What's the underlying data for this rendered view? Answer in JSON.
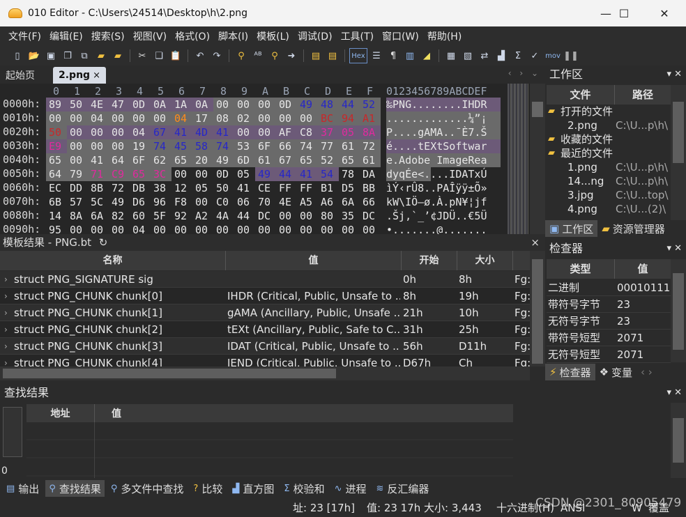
{
  "window": {
    "title": "010 Editor - C:\\Users\\24514\\Desktop\\h\\2.png",
    "controls": {
      "minimize": "—",
      "maximize": "☐",
      "close": "✕"
    }
  },
  "menu": [
    "文件(F)",
    "编辑(E)",
    "搜索(S)",
    "视图(V)",
    "格式(O)",
    "脚本(I)",
    "模板(L)",
    "调试(D)",
    "工具(T)",
    "窗口(W)",
    "帮助(H)"
  ],
  "toolbar": {
    "icons": [
      "new-file-icon",
      "open-folder-icon",
      "save-icon",
      "save-as-icon",
      "save-all-icon",
      "folder-icon",
      "folders-icon",
      "cut-icon",
      "copy-icon",
      "paste-icon",
      "undo-icon",
      "redo-icon",
      "find-icon",
      "find-replace-icon",
      "find-in-files-icon",
      "goto-icon",
      "template-icon",
      "script-icon",
      "hex-mode-icon",
      "text-mode-icon",
      "pilcrow-icon",
      "columns-icon",
      "highlight-icon",
      "calculator-icon",
      "inspector-icon",
      "compare-icon",
      "histogram-icon",
      "checksum-icon",
      "select-icon",
      "mov-icon",
      "pause-icon"
    ],
    "hex_label": "Hex",
    "mov_label": "mov"
  },
  "tabs": {
    "start": "起始页",
    "file": "2.png",
    "close": "×",
    "arrows": "‹ › ⌄"
  },
  "hex": {
    "col_header": [
      "0",
      "1",
      "2",
      "3",
      "4",
      "5",
      "6",
      "7",
      "8",
      "9",
      "A",
      "B",
      "C",
      "D",
      "E",
      "F"
    ],
    "ascii_header": "0123456789ABCDEF",
    "rows": [
      {
        "addr": "0000h:",
        "bytes": [
          "89",
          "50",
          "4E",
          "47",
          "0D",
          "0A",
          "1A",
          "0A",
          "00",
          "00",
          "00",
          "0D",
          "49",
          "48",
          "44",
          "52"
        ],
        "ascii": "‰PNG........IHDR"
      },
      {
        "addr": "0010h:",
        "bytes": [
          "00",
          "00",
          "04",
          "00",
          "00",
          "00",
          "04",
          "17",
          "08",
          "02",
          "00",
          "00",
          "00",
          "BC",
          "94",
          "A1"
        ],
        "ascii": ".............¼”¡"
      },
      {
        "addr": "0020h:",
        "bytes": [
          "50",
          "00",
          "00",
          "00",
          "04",
          "67",
          "41",
          "4D",
          "41",
          "00",
          "00",
          "AF",
          "C8",
          "37",
          "05",
          "8A"
        ],
        "ascii": "P....gAMA..¯È7.Š"
      },
      {
        "addr": "0030h:",
        "bytes": [
          "E9",
          "00",
          "00",
          "00",
          "19",
          "74",
          "45",
          "58",
          "74",
          "53",
          "6F",
          "66",
          "74",
          "77",
          "61",
          "72"
        ],
        "ascii": "é....tEXtSoftwar"
      },
      {
        "addr": "0040h:",
        "bytes": [
          "65",
          "00",
          "41",
          "64",
          "6F",
          "62",
          "65",
          "20",
          "49",
          "6D",
          "61",
          "67",
          "65",
          "52",
          "65",
          "61"
        ],
        "ascii": "e.Adobe ImageRea"
      },
      {
        "addr": "0050h:",
        "bytes": [
          "64",
          "79",
          "71",
          "C9",
          "65",
          "3C",
          "00",
          "00",
          "0D",
          "05",
          "49",
          "44",
          "41",
          "54",
          "78",
          "DA"
        ],
        "ascii": "dyqÉe<....IDATxÚ"
      },
      {
        "addr": "0060h:",
        "bytes": [
          "EC",
          "DD",
          "8B",
          "72",
          "DB",
          "38",
          "12",
          "05",
          "50",
          "41",
          "CE",
          "FF",
          "FF",
          "B1",
          "D5",
          "BB"
        ],
        "ascii": "ìÝ‹rÛ8..PAÎÿÿ±Õ»"
      },
      {
        "addr": "0070h:",
        "bytes": [
          "6B",
          "57",
          "5C",
          "49",
          "D6",
          "96",
          "F8",
          "00",
          "C0",
          "06",
          "70",
          "4E",
          "A5",
          "A6",
          "6A",
          "66"
        ],
        "ascii": "kW\\IÖ–ø.À.pN¥¦jf"
      },
      {
        "addr": "0080h:",
        "bytes": [
          "14",
          "8A",
          "6A",
          "82",
          "60",
          "5F",
          "92",
          "A2",
          "4A",
          "44",
          "DC",
          "00",
          "00",
          "80",
          "35",
          "DC"
        ],
        "ascii": ".Šj‚`_’¢JDÜ..€5Ü"
      },
      {
        "addr": "0090h:",
        "bytes": [
          "95",
          "00",
          "00",
          "00",
          "04",
          "00",
          "00",
          "00",
          "00",
          "00",
          "00",
          "00",
          "00",
          "00",
          "00",
          "00"
        ],
        "ascii": "•.......@......."
      }
    ]
  },
  "template": {
    "title": "模板结果 - PNG.bt",
    "refresh": "↻",
    "close": "×",
    "columns": [
      "名称",
      "值",
      "开始",
      "大小",
      ""
    ],
    "rows": [
      {
        "name": "struct PNG_SIGNATURE sig",
        "value": "",
        "start": "0h",
        "size": "8h",
        "color": "Fg:"
      },
      {
        "name": "struct PNG_CHUNK chunk[0]",
        "value": "IHDR  (Critical, Public, Unsafe to ...",
        "start": "8h",
        "size": "19h",
        "color": "Fg:"
      },
      {
        "name": "struct PNG_CHUNK chunk[1]",
        "value": "gAMA  (Ancillary, Public, Unsafe ...",
        "start": "21h",
        "size": "10h",
        "color": "Fg:"
      },
      {
        "name": "struct PNG_CHUNK chunk[2]",
        "value": "tEXt  (Ancillary, Public, Safe to C...",
        "start": "31h",
        "size": "25h",
        "color": "Fg:"
      },
      {
        "name": "struct PNG_CHUNK chunk[3]",
        "value": "IDAT  (Critical, Public, Unsafe to ...",
        "start": "56h",
        "size": "D11h",
        "color": "Fg:"
      },
      {
        "name": "struct PNG_CHUNK chunk[4]",
        "value": "IEND  (Critical, Public, Unsafe to ...",
        "start": "D67h",
        "size": "Ch",
        "color": "Fg:"
      }
    ]
  },
  "workspace": {
    "title": "工作区",
    "columns": [
      "文件",
      "路径"
    ],
    "items": [
      {
        "indent": 0,
        "folder": true,
        "name": "打开的文件",
        "path": ""
      },
      {
        "indent": 1,
        "folder": false,
        "name": "2.png",
        "path": "C:\\U...p\\h\\"
      },
      {
        "indent": 0,
        "folder": true,
        "name": "收藏的文件",
        "path": ""
      },
      {
        "indent": 0,
        "folder": true,
        "name": "最近的文件",
        "path": ""
      },
      {
        "indent": 1,
        "folder": false,
        "name": "1.png",
        "path": "C:\\U...p\\h\\"
      },
      {
        "indent": 1,
        "folder": false,
        "name": "14...ng",
        "path": "C:\\U...p\\h\\"
      },
      {
        "indent": 1,
        "folder": false,
        "name": "3.jpg",
        "path": "C:\\U...top\\"
      },
      {
        "indent": 1,
        "folder": false,
        "name": "4.png",
        "path": "C:\\U...(2)\\"
      }
    ],
    "tabs": [
      "工作区",
      "资源管理器"
    ]
  },
  "inspector": {
    "title": "检查器",
    "columns": [
      "类型",
      "值"
    ],
    "rows": [
      {
        "type": "二进制",
        "value": "00010111"
      },
      {
        "type": "带符号字节",
        "value": "23"
      },
      {
        "type": "无符号字节",
        "value": "23"
      },
      {
        "type": "带符号短型",
        "value": "2071"
      },
      {
        "type": "无符号短型",
        "value": "2071"
      }
    ],
    "tabs": [
      "检查器",
      "变量"
    ]
  },
  "find": {
    "title": "查找结果",
    "columns": [
      "地址",
      "值"
    ],
    "count": "0"
  },
  "bottom_tabs": [
    "输出",
    "查找结果",
    "多文件中查找",
    "比较",
    "直方图",
    "校验和",
    "进程",
    "反汇编器"
  ],
  "status": {
    "address": "址: 23 [17h]",
    "value": "值: 23 17h",
    "size": "大小: 3,443",
    "encoding": "十六进制(H)",
    "charset": "ANSI",
    "endian": "W",
    "mode": "覆盖"
  },
  "watermark": "CSDN @2301_80905479",
  "colors": {
    "bg": "#262626",
    "hl_gray": "#6a6a6a",
    "hl_purple": "#6c5a78",
    "text_blue": "#2727c8",
    "text_orange": "#ff8c1a",
    "text_pink": "#e02a9e",
    "text_red": "#c8282a"
  }
}
